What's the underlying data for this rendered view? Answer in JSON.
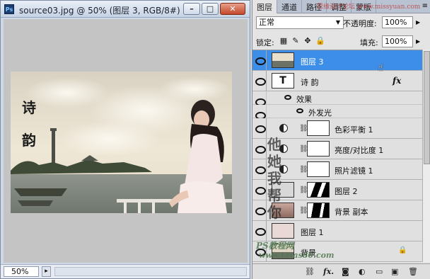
{
  "document": {
    "title": "source03.jpg @ 50% (图层 3, RGB/8#) *",
    "app_icon": "Ps",
    "zoom": "50%",
    "photo_text": [
      "诗",
      "韵"
    ]
  },
  "window_buttons": {
    "minimize": "–",
    "maximize": "□",
    "close": "✕"
  },
  "panel": {
    "tabs": [
      "图层",
      "通道",
      "路径",
      "调整",
      "蒙版"
    ],
    "active_tab": "图层",
    "blend_mode": "正常",
    "opacity_label": "不透明度:",
    "opacity_value": "100%",
    "lock_label": "锁定:",
    "fill_label": "填充:",
    "fill_value": "100%",
    "layers": [
      {
        "name": "图层 3",
        "selected": true
      },
      {
        "name": "诗 韵",
        "type": "text",
        "has_fx": true,
        "fx_label": "fx"
      },
      {
        "name": "效果",
        "type": "effects-group"
      },
      {
        "name": "外发光",
        "type": "effect"
      },
      {
        "name": "色彩平衡 1",
        "type": "adjustment"
      },
      {
        "name": "亮度/对比度 1",
        "type": "adjustment"
      },
      {
        "name": "照片滤镜 1",
        "type": "adjustment"
      },
      {
        "name": "图层 2"
      },
      {
        "name": "背景 副本"
      },
      {
        "name": "图层 1"
      },
      {
        "name": "背景",
        "locked": true
      }
    ],
    "text_thumb": "T"
  },
  "watermarks": {
    "vertical": "他她我帮你",
    "site_line1": "PS教程网",
    "site_line2": "www.tatas80.com",
    "top_right": "思缘设计论坛 www.missyuan.com"
  },
  "colors": {
    "selected_layer": "#3d8ee8",
    "panel_bg": "#e4e4e4",
    "canvas_bg": "#c4c4c4"
  }
}
